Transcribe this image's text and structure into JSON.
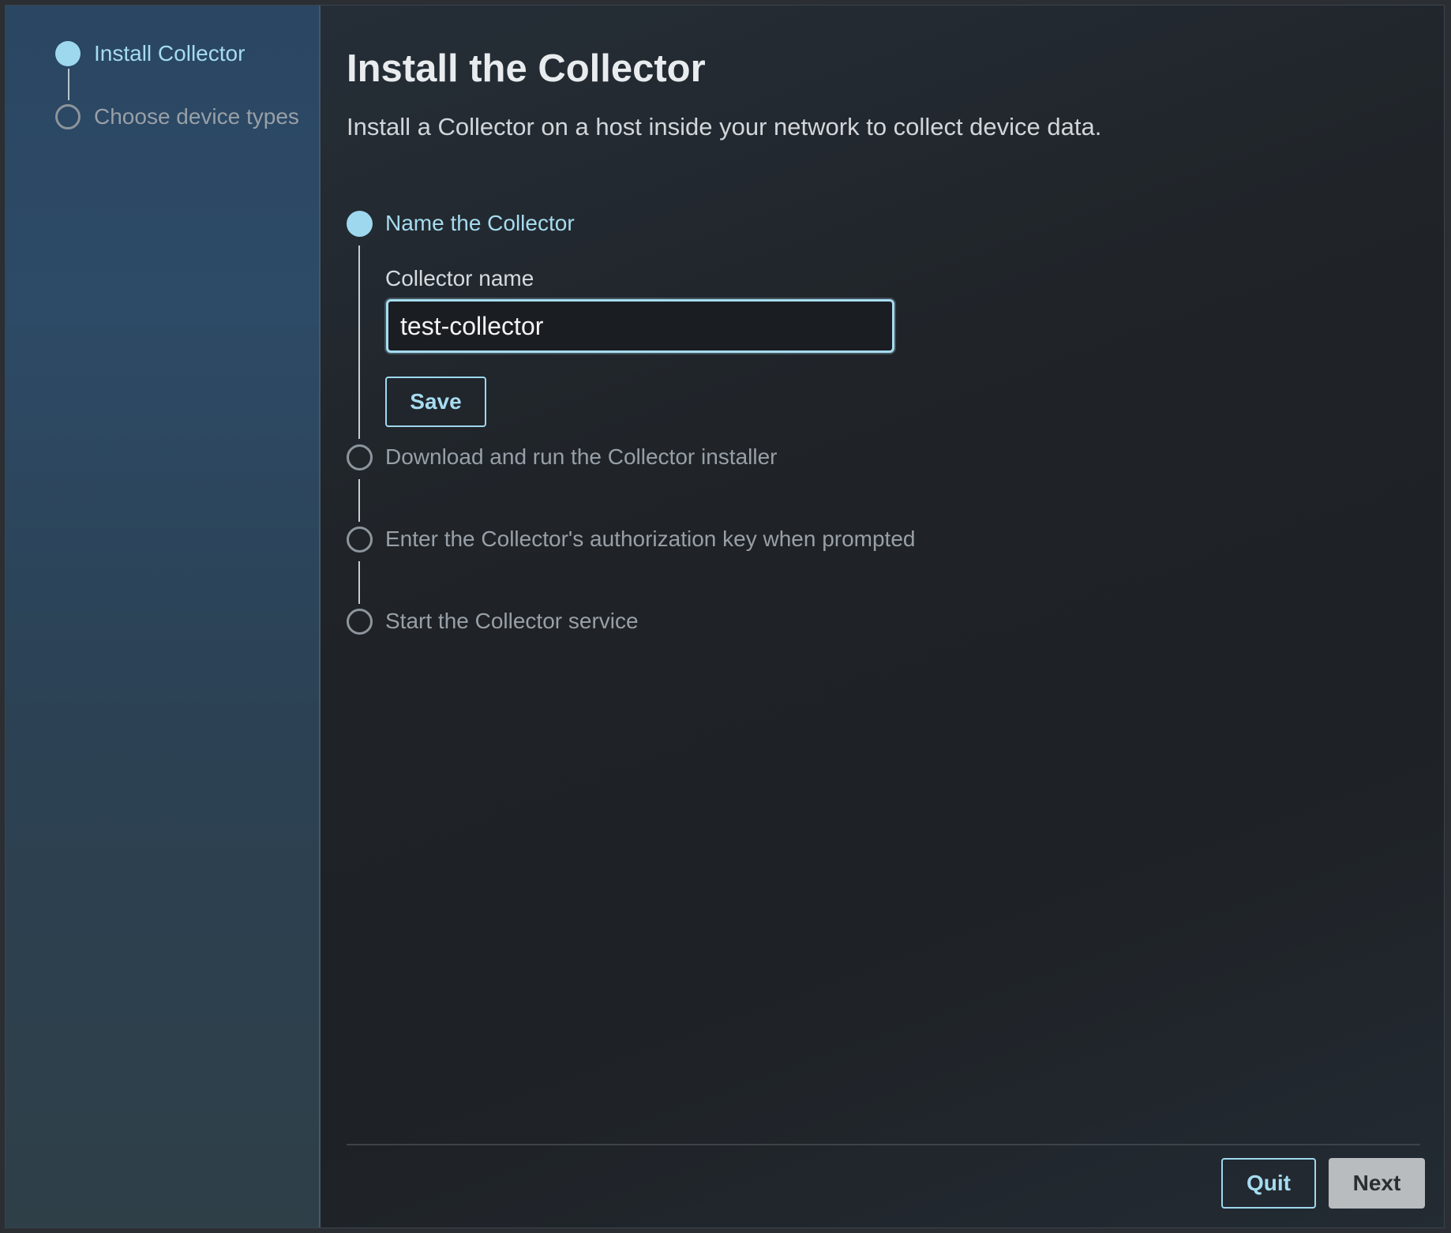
{
  "sidebar": {
    "steps": [
      {
        "label": "Install Collector",
        "state": "active"
      },
      {
        "label": "Choose device types",
        "state": "pending"
      }
    ]
  },
  "main": {
    "title": "Install the Collector",
    "subtitle": "Install a Collector on a host inside your network to collect device data.",
    "substeps": [
      {
        "label": "Name the Collector",
        "state": "active"
      },
      {
        "label": "Download and run the Collector installer",
        "state": "pending"
      },
      {
        "label": "Enter the Collector's authorization key when prompted",
        "state": "pending"
      },
      {
        "label": "Start the Collector service",
        "state": "pending"
      }
    ],
    "collector_name": {
      "label": "Collector name",
      "value": "test-collector"
    },
    "save_label": "Save"
  },
  "footer": {
    "quit_label": "Quit",
    "next_label": "Next"
  },
  "colors": {
    "accent": "#a6dcf0",
    "next_disabled_bg": "#b8bcbf"
  }
}
